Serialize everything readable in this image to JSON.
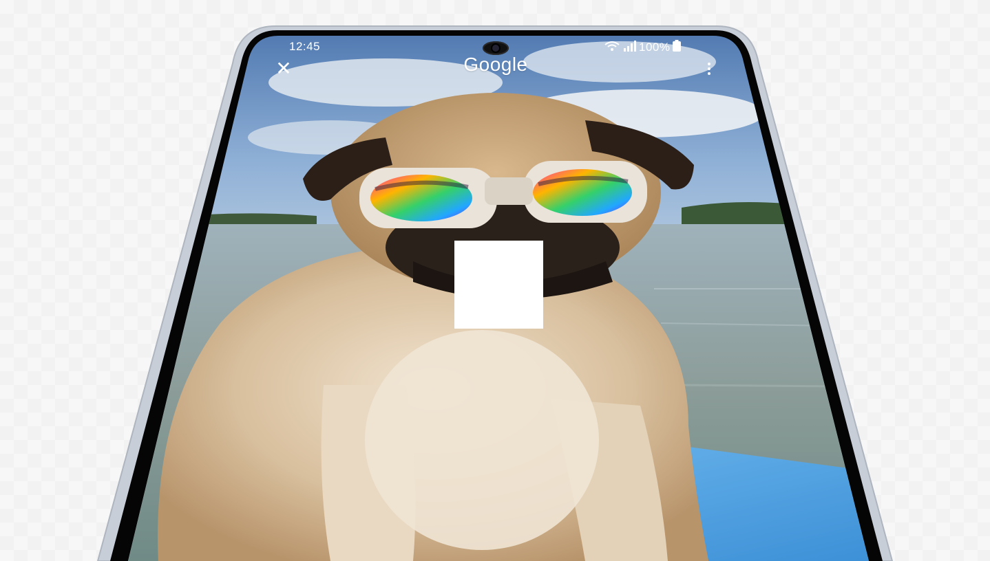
{
  "status_bar": {
    "time": "12:45",
    "battery": "100%",
    "wifi_icon": "wifi-icon",
    "signal_icon": "cell-signal-icon",
    "battery_icon": "battery-icon"
  },
  "app_bar": {
    "title": "Google",
    "close_icon": "close-icon",
    "menu_icon": "more-vert-icon"
  },
  "colors": {
    "sky": "#6f9bd0",
    "water": "#8fa7b2",
    "paddleboard": "#4fa6e6",
    "pug_fur": "#c9a882",
    "phone_frame": "#c9ced6",
    "bezel": "#050505"
  }
}
